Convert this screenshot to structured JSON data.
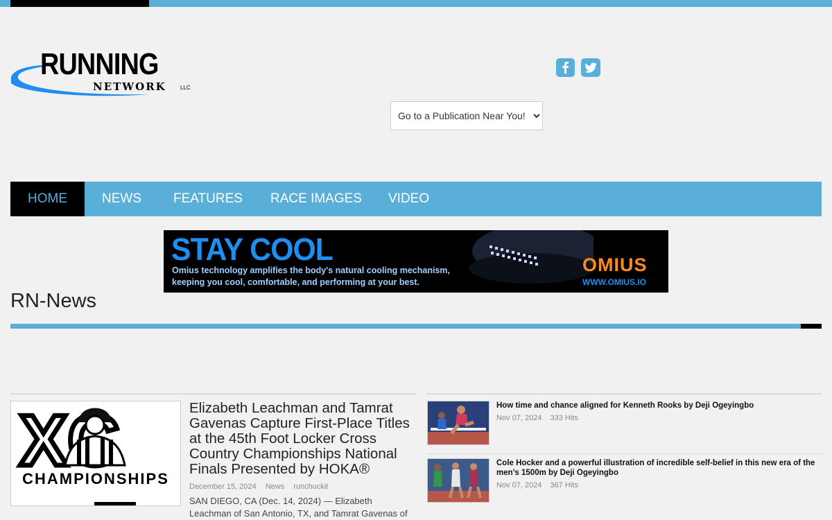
{
  "logo": {
    "primary": "RUNNING",
    "secondary": "NETWORK",
    "suffix": "LLC"
  },
  "social": {
    "facebook_icon": "facebook-icon",
    "twitter_icon": "twitter-icon"
  },
  "publication_select": {
    "selected": "Go to a Publication Near You!"
  },
  "nav": {
    "home": "HOME",
    "news": "NEWS",
    "features": "FEATURES",
    "race_images": "RACE IMAGES",
    "video": "VIDEO"
  },
  "banner": {
    "headline": "STAY COOL",
    "line1": "Omius technology amplifies the body's natural cooling mechanism,",
    "line2": "keeping you cool, comfortable, and performing at your best.",
    "brand": "OMIUS",
    "url": "WWW.OMIUS.IO"
  },
  "section": {
    "title": "RN-News"
  },
  "featured": {
    "image_text_top": "XC",
    "image_text_bottom": "CHAMPIONSHIPS",
    "title": "Elizabeth Leachman and Tamrat Gavenas Capture First-Place Titles at the 45th Foot Locker Cross Country Championships National Finals Presented by HOKA®",
    "date": "December 15, 2024",
    "category": "News",
    "author": "runchuckit",
    "summary": "SAN DIEGO, CA (Dec. 14, 2024) — Elizabeth Leachman of San Antonio, TX, and Tamrat Gavenas of"
  },
  "sidebar": {
    "items": [
      {
        "title": "How time and chance aligned for Kenneth Rooks by Deji Ogeyingbo",
        "date": "Nov 07, 2024",
        "hits": "333 Hits"
      },
      {
        "title": "Cole Hocker and a powerful illustration of incredible self-belief in this new era of the men’s 1500m by Deji Ogeyingbo",
        "date": "Nov 07, 2024",
        "hits": "367 Hits"
      }
    ]
  },
  "colors": {
    "accent": "#5aafd9",
    "dark": "#000000",
    "background": "#f1f1f1"
  }
}
